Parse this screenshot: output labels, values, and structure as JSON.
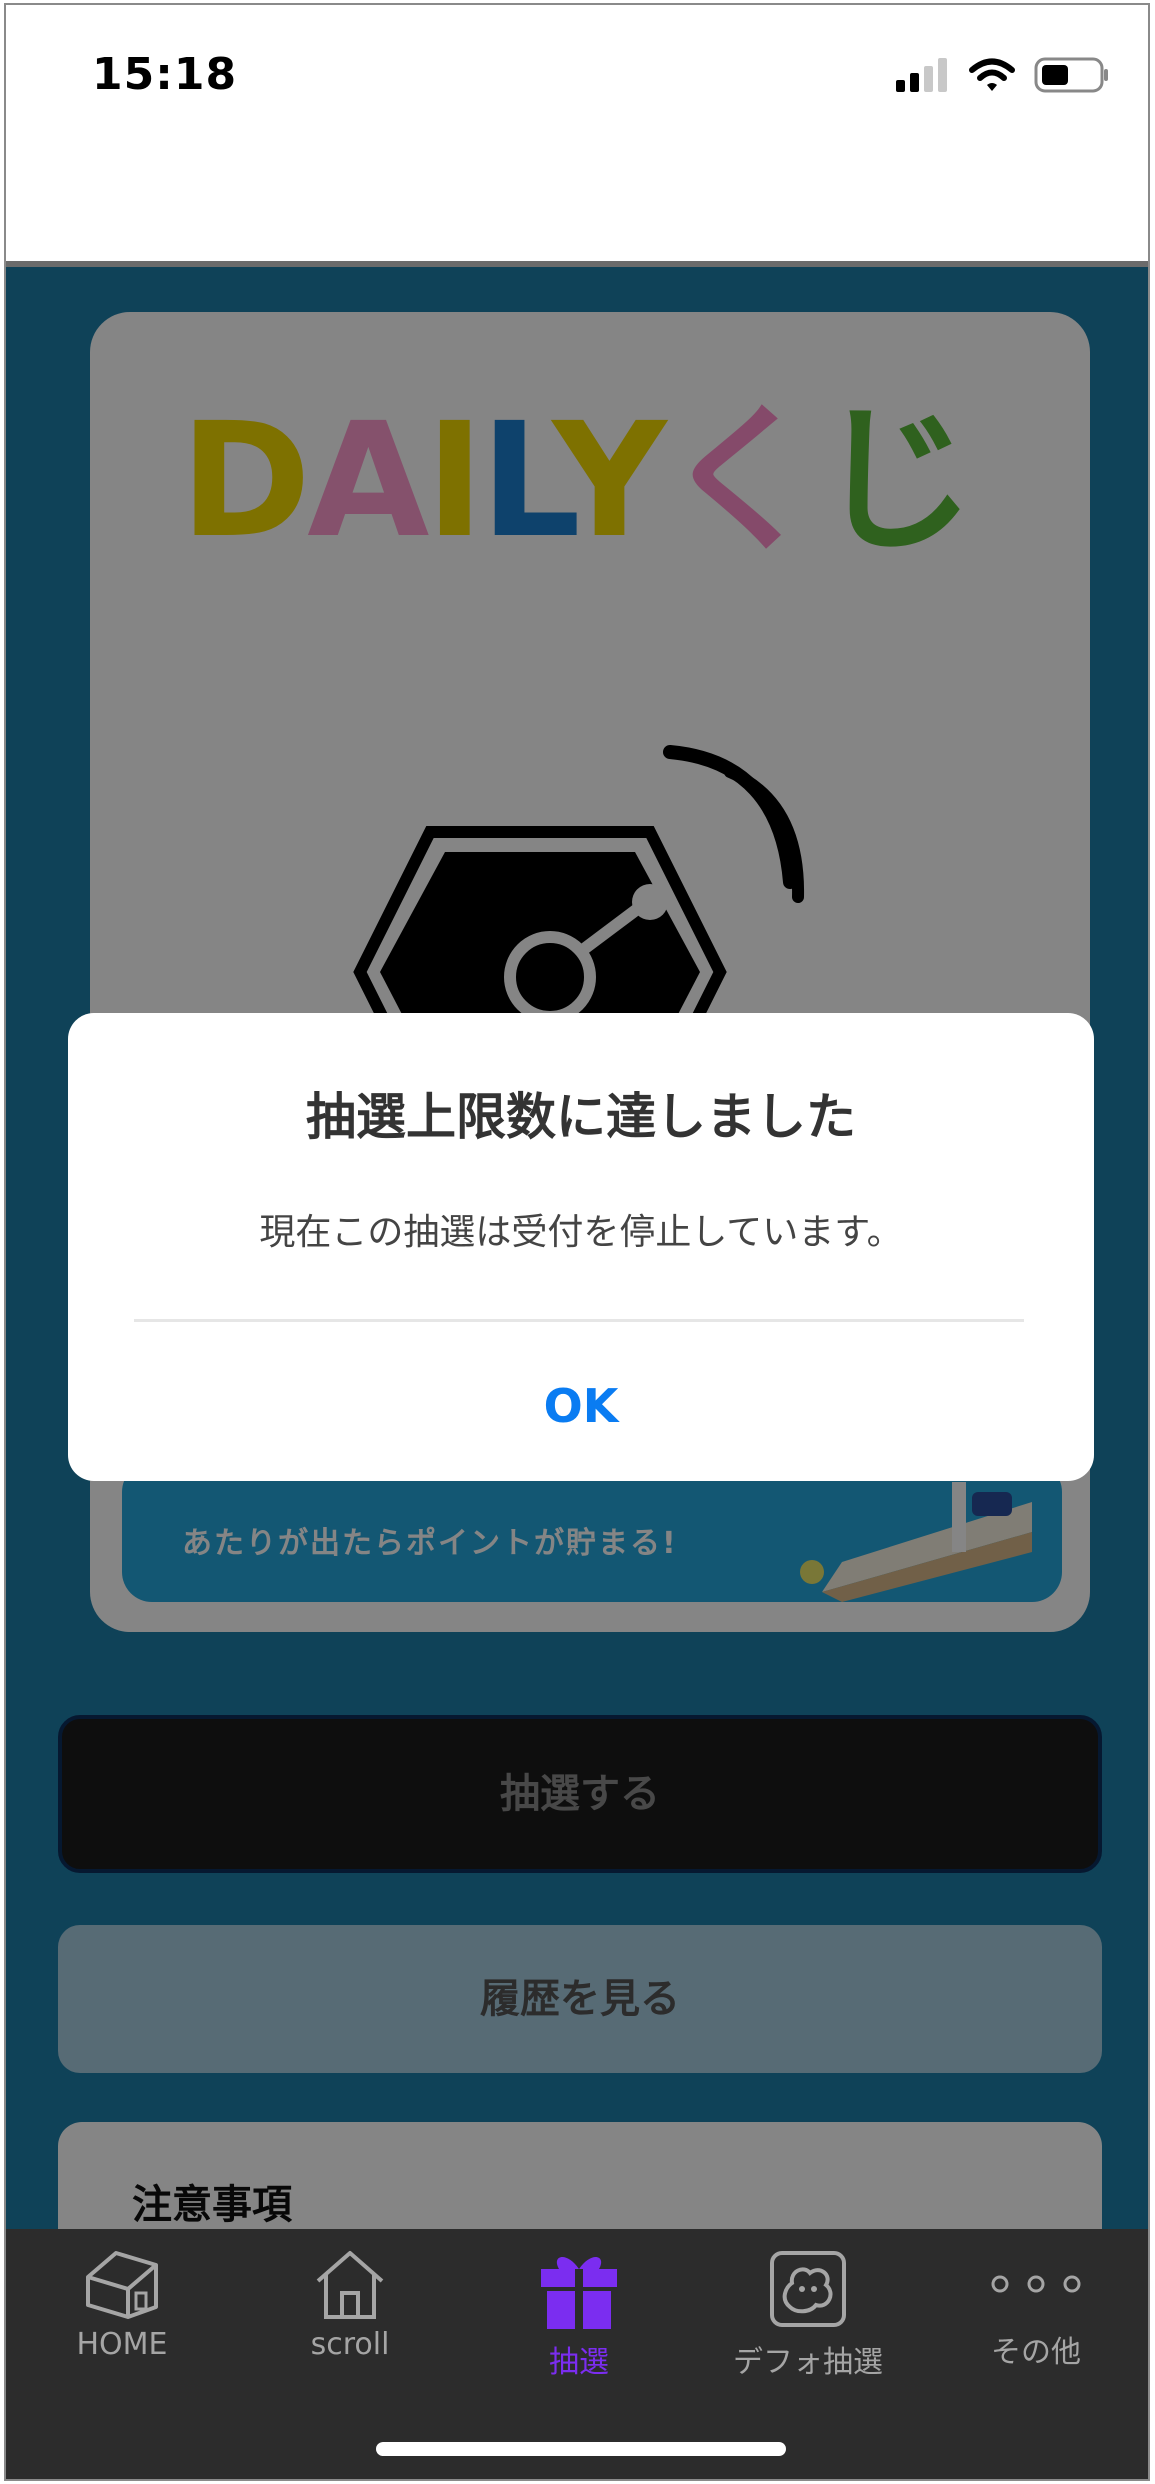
{
  "status_bar": {
    "time": "15:18"
  },
  "card": {
    "logo": {
      "letters": [
        "D",
        "A",
        "I",
        "L",
        "Y",
        "く",
        "じ"
      ],
      "colors": [
        "#f3de1f",
        "#ff9bd0",
        "#f3de1f",
        "#2ca24f",
        "#1679c8",
        "#f3de1f",
        "#ff7ec3",
        "#58b83e"
      ]
    },
    "banner_text": "あたりが出たらポイントが貯まる!"
  },
  "buttons": {
    "draw": "抽選する",
    "history": "履歴を見る"
  },
  "notes": {
    "title": "注意事項"
  },
  "dialog": {
    "title": "抽選上限数に達しました",
    "message": "現在この抽選は受付を停止しています。",
    "ok": "OK"
  },
  "tabbar": {
    "items": [
      {
        "label": "HOME",
        "icon": "house-3d-icon",
        "active": false
      },
      {
        "label": "scroll",
        "icon": "house-icon",
        "active": false
      },
      {
        "label": "抽選",
        "icon": "gift-icon",
        "active": true
      },
      {
        "label": "デフォ抽選",
        "icon": "blob-card-icon",
        "active": false
      },
      {
        "label": "その他",
        "icon": "more-dots-icon",
        "active": false
      }
    ],
    "active_color": "#7b2df0",
    "inactive_color": "#a5a5a5"
  }
}
